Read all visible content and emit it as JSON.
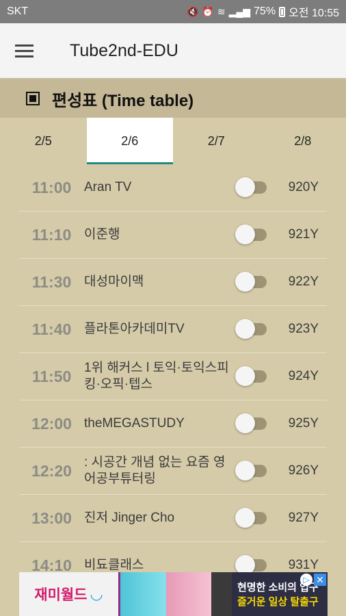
{
  "status_bar": {
    "carrier": "SKT",
    "battery": "75%",
    "time": "오전 10:55"
  },
  "app": {
    "title": "Tube2nd-EDU"
  },
  "section": {
    "title": "편성표 (Time table)"
  },
  "tabs": [
    {
      "label": "2/5",
      "active": false
    },
    {
      "label": "2/6",
      "active": true
    },
    {
      "label": "2/7",
      "active": false
    },
    {
      "label": "2/8",
      "active": false
    }
  ],
  "schedule": [
    {
      "time": "11:00",
      "name": "Aran TV",
      "channel": "920Y"
    },
    {
      "time": "11:10",
      "name": "이준행",
      "channel": "921Y"
    },
    {
      "time": "11:30",
      "name": "대성마이맥",
      "channel": "922Y"
    },
    {
      "time": "11:40",
      "name": "플라톤아카데미TV",
      "channel": "923Y"
    },
    {
      "time": "11:50",
      "name": "1위 해커스 l 토익·토익스피킹·오픽·텝스",
      "channel": "924Y"
    },
    {
      "time": "12:00",
      "name": "theMEGASTUDY",
      "channel": "925Y"
    },
    {
      "time": "12:20",
      "name": ": 시공간 개념 없는 요즘 영어공부튜터링",
      "channel": "926Y"
    },
    {
      "time": "13:00",
      "name": "진저 Jinger Cho",
      "channel": "927Y"
    },
    {
      "time": "14:10",
      "name": "비됴클래스",
      "channel": "931Y"
    }
  ],
  "ad": {
    "brand": "재미월드",
    "line1": "현명한 소비의 입구",
    "line2": "즐거운 일상 탈출구"
  },
  "colors": {
    "background": "#d5cba9",
    "header": "#c5b896",
    "tab_indicator": "#1f8a7e"
  }
}
